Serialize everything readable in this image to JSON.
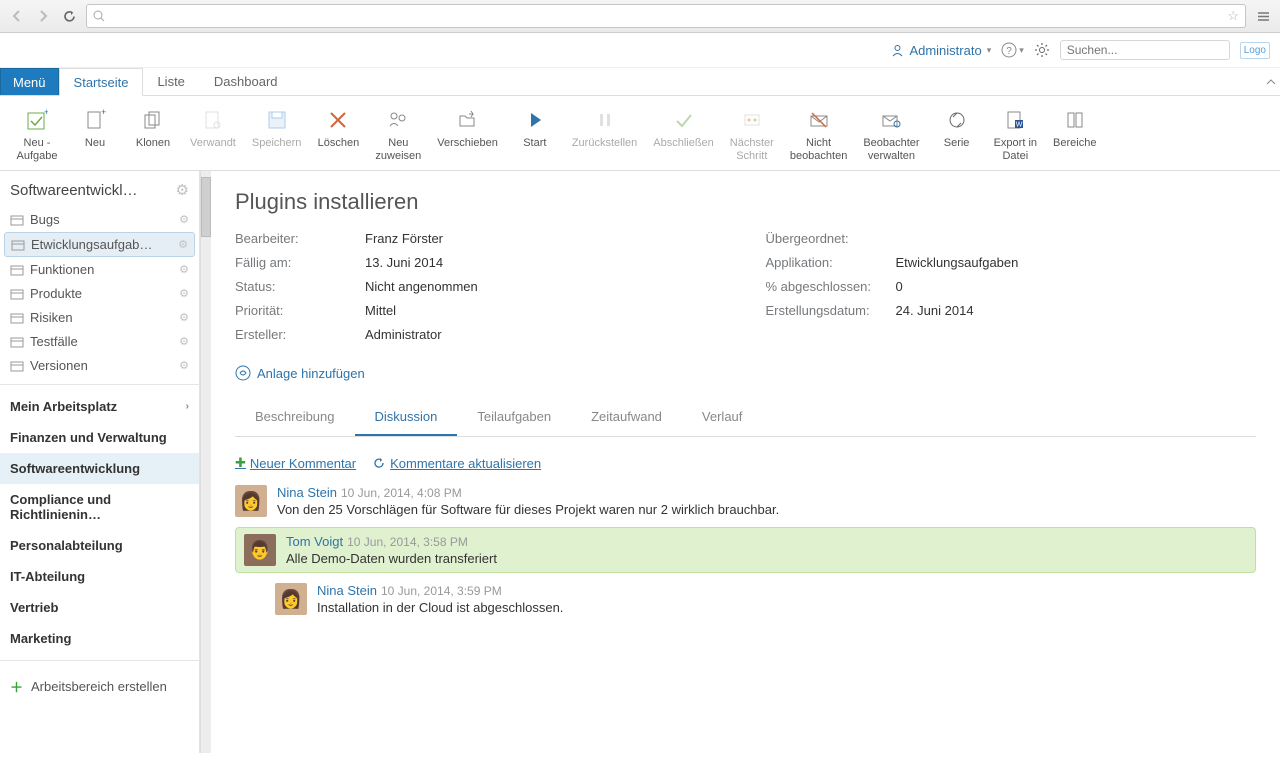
{
  "browser": {
    "url": ""
  },
  "topbar": {
    "user": "Administrato",
    "search_placeholder": "Suchen...",
    "logo_text": "Logo"
  },
  "main_tabs": {
    "menu": "Menü",
    "items": [
      "Startseite",
      "Liste",
      "Dashboard"
    ],
    "active_index": 0
  },
  "toolbar": [
    {
      "label": "Neu -\nAufgabe",
      "icon": "check-new",
      "disabled": false
    },
    {
      "label": "Neu",
      "icon": "doc-new",
      "disabled": false
    },
    {
      "label": "Klonen",
      "icon": "docs",
      "disabled": false
    },
    {
      "label": "Verwandt",
      "icon": "doc-link",
      "disabled": true
    },
    {
      "label": "Speichern",
      "icon": "save",
      "disabled": true
    },
    {
      "label": "Löschen",
      "icon": "delete",
      "disabled": false
    },
    {
      "label": "Neu\nzuweisen",
      "icon": "people",
      "disabled": false
    },
    {
      "label": "Verschieben",
      "icon": "folder-move",
      "disabled": false
    },
    {
      "label": "Start",
      "icon": "play",
      "disabled": false
    },
    {
      "label": "Zurückstellen",
      "icon": "pause",
      "disabled": true
    },
    {
      "label": "Abschließen",
      "icon": "check",
      "disabled": true
    },
    {
      "label": "Nächster\nSchritt",
      "icon": "step",
      "disabled": true
    },
    {
      "label": "Nicht\nbeobachten",
      "icon": "unwatch",
      "disabled": false
    },
    {
      "label": "Beobachter\nverwalten",
      "icon": "watchers",
      "disabled": false
    },
    {
      "label": "Serie",
      "icon": "series",
      "disabled": false
    },
    {
      "label": "Export in\nDatei",
      "icon": "export",
      "disabled": false
    },
    {
      "label": "Bereiche",
      "icon": "panels",
      "disabled": false
    }
  ],
  "sidebar": {
    "tree_header": "Softwareentwickl…",
    "tree": [
      {
        "label": "Bugs"
      },
      {
        "label": "Etwicklungsaufgab…",
        "active": true
      },
      {
        "label": "Funktionen"
      },
      {
        "label": "Produkte"
      },
      {
        "label": "Risiken"
      },
      {
        "label": "Testfälle"
      },
      {
        "label": "Versionen"
      }
    ],
    "sections": [
      {
        "label": "Mein Arbeitsplatz",
        "expandable": true
      },
      {
        "label": "Finanzen und Verwaltung"
      },
      {
        "label": "Softwareentwicklung",
        "active": true
      },
      {
        "label": "Compliance und Richtlinienin…"
      },
      {
        "label": "Personalabteilung"
      },
      {
        "label": "IT-Abteilung"
      },
      {
        "label": "Vertrieb"
      },
      {
        "label": "Marketing"
      }
    ],
    "create_label": "Arbeitsbereich erstellen"
  },
  "record": {
    "title": "Plugins installieren",
    "fields_left": [
      {
        "label": "Bearbeiter:",
        "value": "Franz Förster"
      },
      {
        "label": "Fällig am:",
        "value": "13. Juni 2014"
      },
      {
        "label": "Status:",
        "value": "Nicht angenommen"
      },
      {
        "label": "Priorität:",
        "value": "Mittel"
      },
      {
        "label": "Ersteller:",
        "value": "Administrator"
      }
    ],
    "fields_right": [
      {
        "label": "Übergeordnet:",
        "value": ""
      },
      {
        "label": "Applikation:",
        "value": "Etwicklungsaufgaben"
      },
      {
        "label": "% abgeschlossen:",
        "value": "0"
      },
      {
        "label": "Erstellungsdatum:",
        "value": "24. Juni 2014"
      }
    ],
    "attach_label": "Anlage hinzufügen"
  },
  "subtabs": [
    "Beschreibung",
    "Diskussion",
    "Teilaufgaben",
    "Zeitaufwand",
    "Verlauf"
  ],
  "subtabs_active": 1,
  "discussion": {
    "new_comment": "Neuer Kommentar",
    "refresh": "Kommentare aktualisieren",
    "comments": [
      {
        "author": "Nina Stein",
        "time": "10 Jun, 2014, 4:08 PM",
        "text": "Von den 25 Vorschlägen für Software für dieses Projekt waren nur 2 wirklich brauchbar.",
        "indent": 0,
        "avatar": "f"
      },
      {
        "author": "Tom Voigt",
        "time": "10 Jun, 2014, 3:58 PM",
        "text": "Alle Demo-Daten wurden transferiert",
        "indent": 0,
        "avatar": "m",
        "highlight": true
      },
      {
        "author": "Nina Stein",
        "time": "10 Jun, 2014, 3:59 PM",
        "text": "Installation in der Cloud ist abgeschlossen.",
        "indent": 1,
        "avatar": "f"
      }
    ]
  }
}
